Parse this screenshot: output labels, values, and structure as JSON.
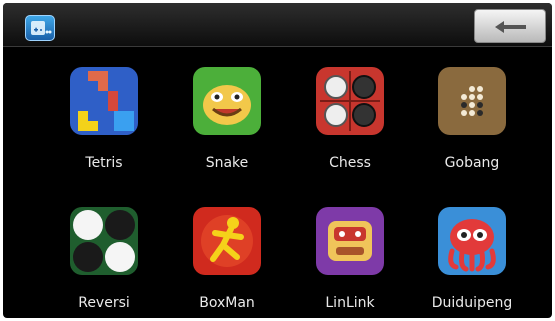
{
  "header": {
    "app_icon": "game-box-icon",
    "back_icon": "back-arrow-icon"
  },
  "games": [
    {
      "label": "Tetris",
      "icon": "tetris-icon",
      "color": "#2f5fc7"
    },
    {
      "label": "Snake",
      "icon": "snake-icon",
      "color": "#4caf3a"
    },
    {
      "label": "Chess",
      "icon": "chess-icon",
      "color": "#c8362e"
    },
    {
      "label": "Gobang",
      "icon": "gobang-icon",
      "color": "#8a6a3e"
    },
    {
      "label": "Reversi",
      "icon": "reversi-icon",
      "color": "#1f5e2e"
    },
    {
      "label": "BoxMan",
      "icon": "boxman-icon",
      "color": "#d02a1e"
    },
    {
      "label": "LinLink",
      "icon": "linlink-icon",
      "color": "#7e3aa8"
    },
    {
      "label": "Duiduipeng",
      "icon": "duiduipeng-icon",
      "color": "#3a8fd8"
    }
  ]
}
